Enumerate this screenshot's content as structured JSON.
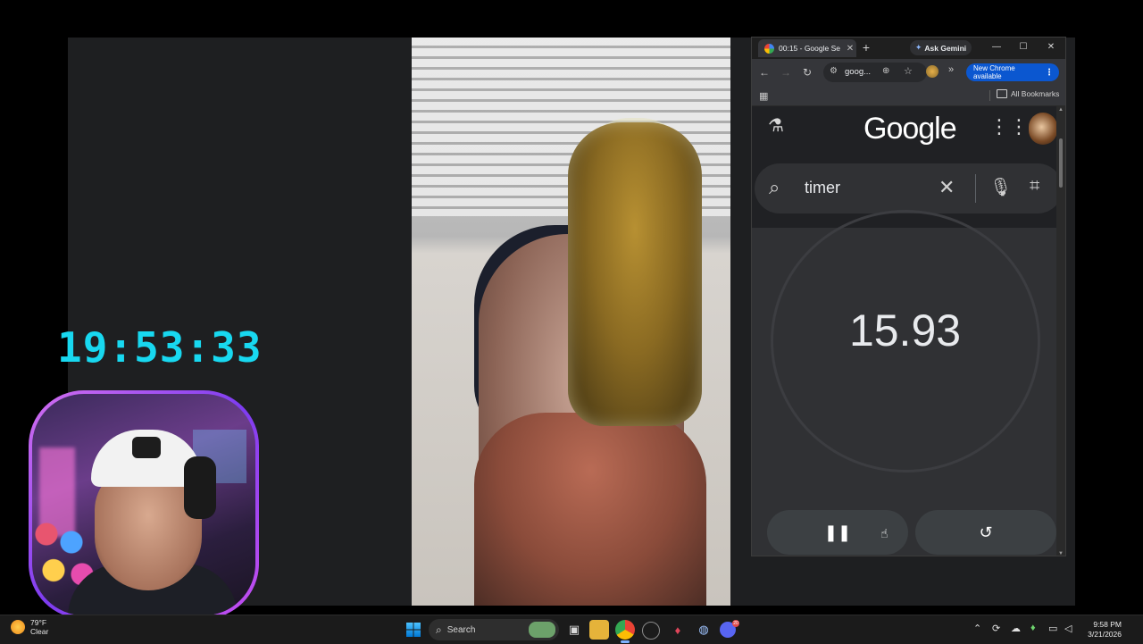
{
  "stream": {
    "clock": "19:53:33"
  },
  "chrome": {
    "tab_title": "00:15 - Google Se",
    "tab_close": "✕",
    "new_tab": "+",
    "ask_gemini": "Ask Gemini",
    "window_controls": {
      "minimize": "—",
      "maximize": "☐",
      "close": "✕"
    },
    "toolbar": {
      "back": "←",
      "forward": "→",
      "reload": "↻",
      "url": "goog...",
      "new_chrome": "New Chrome available",
      "more": "⋮"
    },
    "bookmarks": {
      "all_bookmarks": "All Bookmarks"
    }
  },
  "google_page": {
    "logo": "Google",
    "search_query": "timer",
    "timer_value": "15.93",
    "pause_label": "❚❚",
    "reset_label": "↺"
  },
  "taskbar": {
    "weather_temp": "79°F",
    "weather_cond": "Clear",
    "search_label": "Search",
    "time": "9:58 PM",
    "date": "3/21/2026",
    "discord_badge": "20"
  },
  "icons": {
    "labs": "flask-icon",
    "apps": "apps-grid-icon",
    "search": "search-icon",
    "clear": "close-icon",
    "mic": "mic-icon",
    "lens": "lens-icon"
  },
  "colors": {
    "clock": "#18d8f0",
    "chrome_update": "#0b57d0",
    "timer_bg": "#303134",
    "webcam_frame": "#9b4cf0"
  }
}
